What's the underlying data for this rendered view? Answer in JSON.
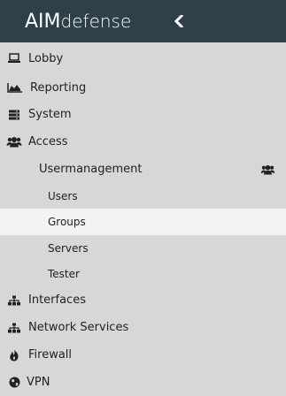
{
  "header": {
    "logo_part1": "AIM",
    "logo_part2": "defense",
    "collapse_icon": "chevron-left-icon"
  },
  "colors": {
    "header_bg": "#2e4049",
    "menu_bg": "#d7d7d7",
    "active_bg": "#f3f3f3"
  },
  "menu": {
    "lobby": "Lobby",
    "reporting": "Reporting",
    "system": "System",
    "access": "Access",
    "usermanagement": "Usermanagement",
    "users": "Users",
    "groups": "Groups",
    "servers": "Servers",
    "tester": "Tester",
    "interfaces": "Interfaces",
    "network_services": "Network Services",
    "firewall": "Firewall",
    "vpn": "VPN"
  }
}
